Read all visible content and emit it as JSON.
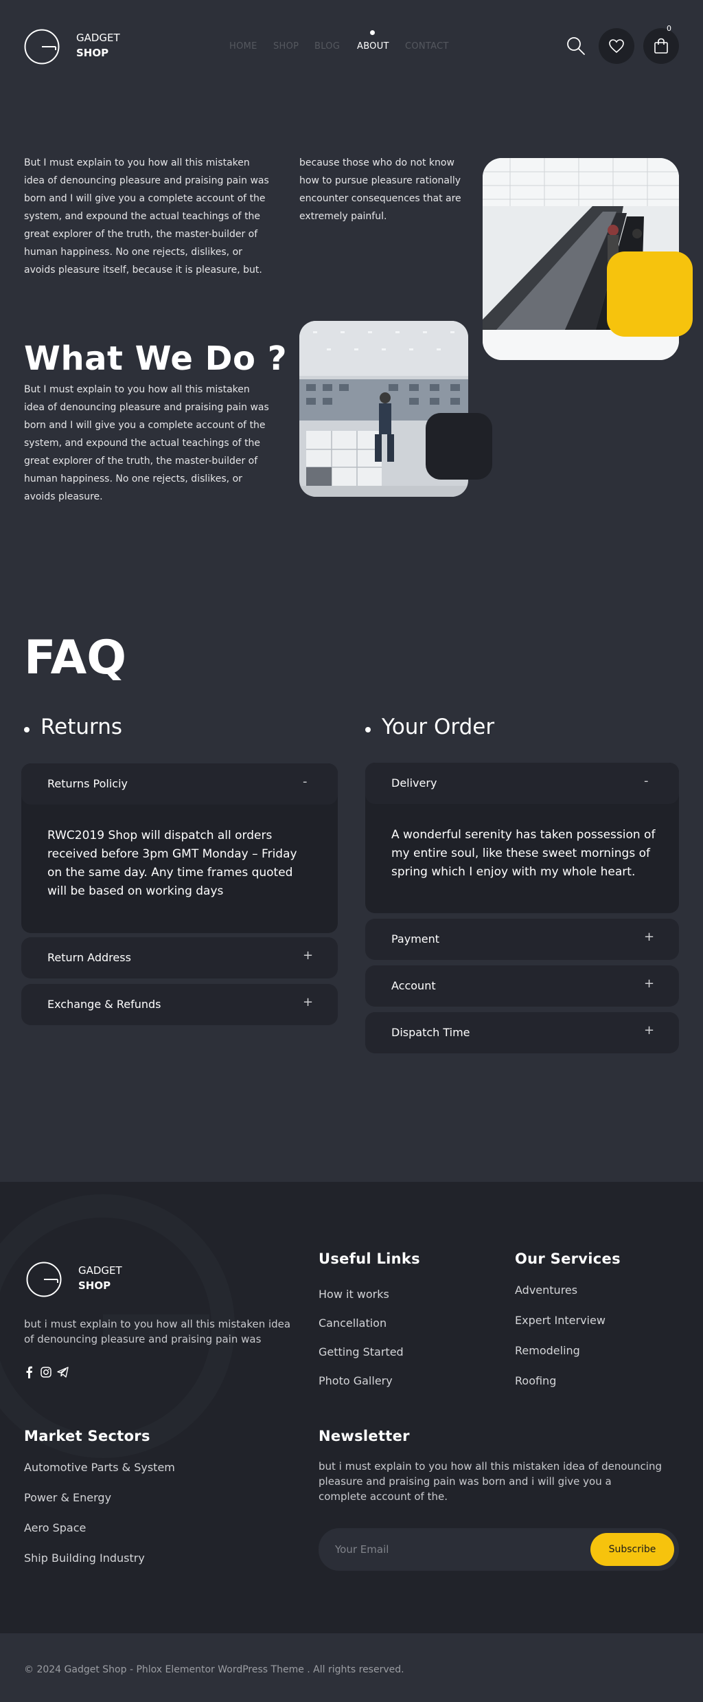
{
  "header": {
    "logo_line1": "GADGET",
    "logo_line2": "SHOP",
    "nav": [
      "HOME",
      "SHOP",
      "BLOG",
      "ABOUT",
      "CONTACT"
    ],
    "active_nav": "ABOUT",
    "cart_count": "0"
  },
  "about": {
    "para1": "But I must explain to you how all this mistaken idea of denouncing pleasure and praising pain was born and I will give you a complete account of the system, and expound the actual teachings of the great explorer of the truth, the master-builder of human happiness. No one rejects, dislikes, or avoids pleasure itself, because it is pleasure, but.",
    "para2": "because those who do not know how to pursue pleasure rationally encounter consequences that are extremely painful.",
    "what_title": "What We Do ?",
    "para3": "But I must explain to you how all this mistaken idea of denouncing pleasure and praising pain was born and I will give you a complete account of the system, and expound the actual teachings of the great explorer of the truth, the master-builder of human happiness. No one rejects, dislikes, or avoids pleasure."
  },
  "faq": {
    "title": "FAQ",
    "left_heading": "Returns",
    "right_heading": "Your Order",
    "left_items": [
      {
        "q": "Returns Policiy",
        "sign": "-",
        "answer": "RWC2019 Shop will dispatch all orders received before 3pm GMT Monday – Friday on the same day. Any time frames quoted will be based on working days"
      },
      {
        "q": "Return Address",
        "sign": "+"
      },
      {
        "q": "Exchange & Refunds",
        "sign": "+"
      }
    ],
    "right_items": [
      {
        "q": "Delivery",
        "sign": "-",
        "answer": " A wonderful serenity has taken possession of my entire soul, like these sweet mornings of spring which I enjoy with my whole heart."
      },
      {
        "q": "Payment",
        "sign": "+"
      },
      {
        "q": "Account",
        "sign": "+"
      },
      {
        "q": "Dispatch Time",
        "sign": "+"
      }
    ]
  },
  "footer": {
    "logo_line1": "GADGET",
    "logo_line2": "SHOP",
    "about_text": "but i must explain to you how all this mistaken idea of denouncing pleasure and praising pain was",
    "useful_links_title": "Useful Links",
    "useful_links": [
      "How it works",
      "Cancellation",
      "Getting Started",
      "Photo Gallery"
    ],
    "services_title": "Our Services",
    "services": [
      "Adventures",
      "Expert Interview",
      "Remodeling",
      "Roofing"
    ],
    "sectors_title": "Market Sectors",
    "sectors": [
      "Automotive Parts & System",
      "Power & Energy",
      "Aero Space",
      "Ship Building Industry"
    ],
    "newsletter_title": "Newsletter",
    "newsletter_text": "but i must explain to you how all this mistaken idea of denouncing pleasure and praising pain was born and i will give you a complete account of the.",
    "email_placeholder": "Your Email",
    "subscribe_label": "Subscribe",
    "copyright": "© 2024 Gadget Shop - Phlox Elementor WordPress Theme . All rights reserved."
  },
  "colors": {
    "background": "#2d3039",
    "footer_bg": "#21232a",
    "accent_yellow": "#f6c30d",
    "card_bg": "#23252d"
  }
}
